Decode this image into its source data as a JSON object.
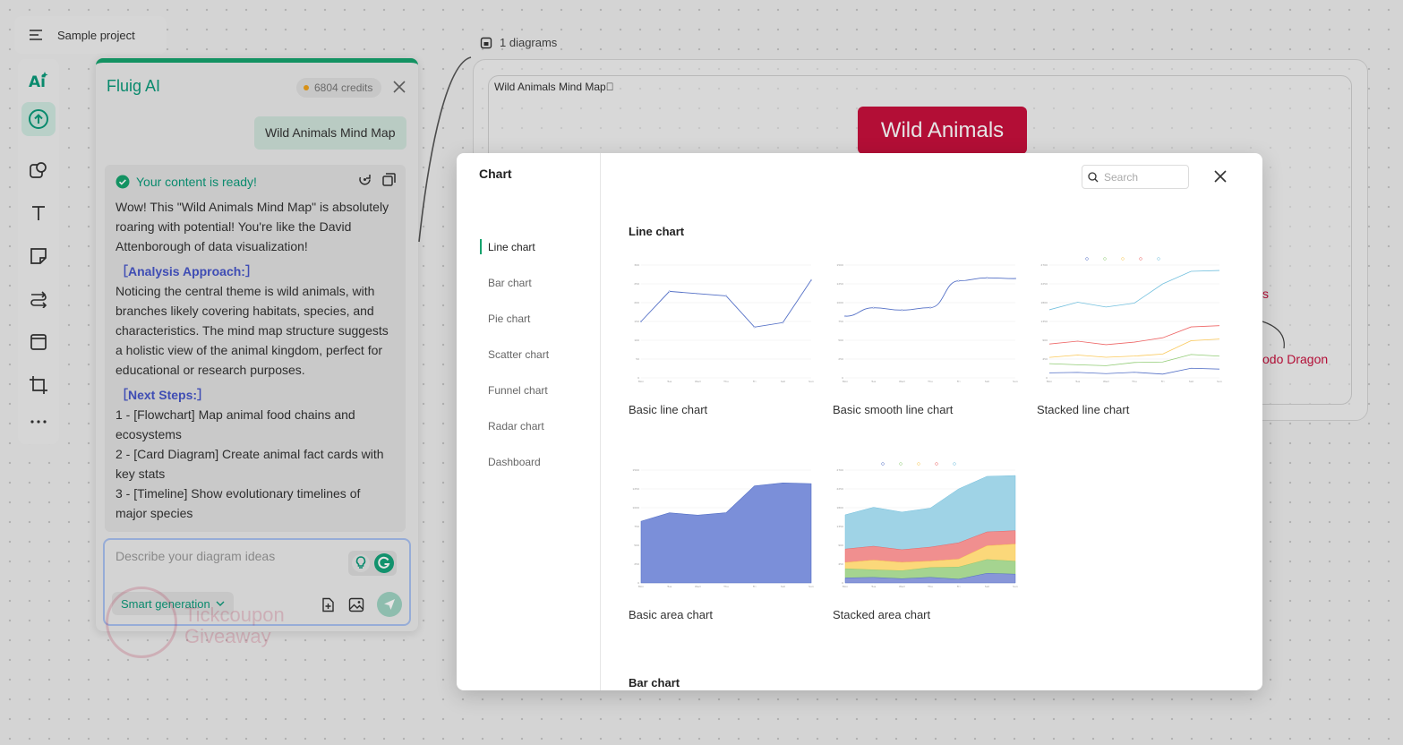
{
  "project": {
    "title": "Sample project"
  },
  "toolbar": {
    "items": [
      "ai-icon",
      "upload-icon",
      "shapes-icon",
      "text-icon",
      "sticky-note-icon",
      "connector-icon",
      "frame-icon",
      "crop-icon",
      "more-icon"
    ]
  },
  "canvas": {
    "diagrams_label": "1 diagrams",
    "frame_title": "Wild Animals Mind Map",
    "root_node": "Wild Animals",
    "peek_node_1": "s",
    "peek_node_2": "odo Dragon"
  },
  "ai_panel": {
    "title": "Fluig AI",
    "credits": "6804 credits",
    "user_message": "Wild Animals Mind Map",
    "ready_text": "Your content is ready!",
    "intro": "Wow! This \"Wild Animals Mind Map\" is absolutely roaring with potential! You're like the David Attenborough of data visualization!",
    "analysis_heading": "［Analysis Approach:］",
    "analysis_text": "Noticing the central theme is wild animals, with branches likely covering habitats, species, and characteristics. The mind map structure suggests a holistic view of the animal kingdom, perfect for educational or research purposes.",
    "next_heading": "［Next Steps:］",
    "steps": [
      "1 - [Flowchart] Map animal food chains and ecosystems",
      "2 - [Card Diagram] Create animal fact cards with key stats",
      "3 - [Timeline] Show evolutionary timelines of major species"
    ],
    "input_placeholder": "Describe your diagram ideas",
    "mode": "Smart generation"
  },
  "watermark": {
    "line1": "Tickcoupon",
    "line2": "Giveaway"
  },
  "modal": {
    "title": "Chart",
    "search_placeholder": "Search",
    "nav": [
      "Line chart",
      "Bar chart",
      "Pie chart",
      "Scatter chart",
      "Funnel chart",
      "Radar chart",
      "Dashboard"
    ],
    "active_nav": "Line chart",
    "section_line": "Line chart",
    "section_bar": "Bar chart",
    "cards": [
      "Basic line chart",
      "Basic smooth line chart",
      "Stacked line chart",
      "Basic area chart",
      "Stacked area chart"
    ]
  },
  "colors": {
    "accent": "#16a36e",
    "brand_red": "#c8103d",
    "link_blue": "#4756c9"
  },
  "chart_data": [
    {
      "type": "line",
      "categories": [
        "Mon",
        "Tue",
        "Wed",
        "Thu",
        "Fri",
        "Sat",
        "Sun"
      ],
      "values": [
        150,
        230,
        224,
        218,
        135,
        147,
        260
      ],
      "ylim": [
        0,
        300
      ]
    },
    {
      "type": "line",
      "smooth": true,
      "categories": [
        "Mon",
        "Tue",
        "Wed",
        "Thu",
        "Fri",
        "Sat",
        "Sun"
      ],
      "values": [
        820,
        932,
        901,
        934,
        1290,
        1330,
        1320
      ],
      "ylim": [
        0,
        1500
      ]
    },
    {
      "type": "line",
      "stacked": true,
      "categories": [
        "Mon",
        "Tue",
        "Wed",
        "Thu",
        "Fri",
        "Sat",
        "Sun"
      ],
      "series": [
        {
          "values": [
            120,
            132,
            101,
            134,
            90,
            230,
            210
          ]
        },
        {
          "values": [
            220,
            182,
            191,
            234,
            290,
            330,
            310
          ]
        },
        {
          "values": [
            150,
            232,
            201,
            154,
            190,
            330,
            410
          ]
        },
        {
          "values": [
            320,
            332,
            301,
            334,
            390,
            330,
            320
          ]
        },
        {
          "values": [
            820,
            932,
            901,
            934,
            1290,
            1330,
            1320
          ]
        }
      ],
      "colors": [
        "#5470c6",
        "#91cc75",
        "#fac858",
        "#ee6666",
        "#73c0de"
      ]
    },
    {
      "type": "area",
      "categories": [
        "Mon",
        "Tue",
        "Wed",
        "Thu",
        "Fri",
        "Sat",
        "Sun"
      ],
      "values": [
        820,
        932,
        901,
        934,
        1290,
        1330,
        1320
      ],
      "ylim": [
        0,
        1500
      ]
    },
    {
      "type": "area",
      "stacked": true,
      "categories": [
        "Mon",
        "Tue",
        "Wed",
        "Thu",
        "Fri",
        "Sat",
        "Sun"
      ],
      "series": [
        {
          "values": [
            120,
            132,
            101,
            134,
            90,
            230,
            210
          ]
        },
        {
          "values": [
            220,
            182,
            191,
            234,
            290,
            330,
            310
          ]
        },
        {
          "values": [
            150,
            232,
            201,
            154,
            190,
            330,
            410
          ]
        },
        {
          "values": [
            320,
            332,
            301,
            334,
            390,
            330,
            320
          ]
        },
        {
          "values": [
            820,
            932,
            901,
            934,
            1290,
            1330,
            1320
          ]
        }
      ],
      "colors": [
        "#5470c6",
        "#91cc75",
        "#fac858",
        "#ee6666",
        "#73c0de"
      ]
    }
  ]
}
